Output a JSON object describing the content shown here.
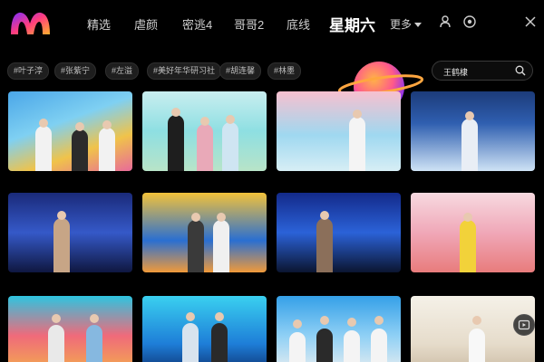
{
  "brand": {
    "logo_icon": "m-logo-icon",
    "accent_colors": [
      "#ff3d7f",
      "#ff9a2e",
      "#7b2cff"
    ]
  },
  "nav": {
    "items": [
      {
        "label": "精选"
      },
      {
        "label": "虐颜"
      },
      {
        "label": "密逃4"
      },
      {
        "label": "哥哥2"
      },
      {
        "label": "底线"
      },
      {
        "label": "星期六",
        "active": true
      }
    ],
    "more_label": "更多",
    "icons": [
      "user-icon",
      "target-icon",
      "close-icon"
    ]
  },
  "tags": [
    "#叶子淳",
    "#张紫宁",
    "#左溢",
    "#美好年华研习社",
    "#胡连馨",
    "#林墨"
  ],
  "search": {
    "value": "王鹤棣",
    "icon": "search-icon"
  },
  "thumbnails": [
    {
      "alt": "thumbnail-1"
    },
    {
      "alt": "thumbnail-2"
    },
    {
      "alt": "thumbnail-3"
    },
    {
      "alt": "thumbnail-4"
    },
    {
      "alt": "thumbnail-5"
    },
    {
      "alt": "thumbnail-6"
    },
    {
      "alt": "thumbnail-7"
    },
    {
      "alt": "thumbnail-8"
    },
    {
      "alt": "thumbnail-9"
    },
    {
      "alt": "thumbnail-10"
    },
    {
      "alt": "thumbnail-11"
    },
    {
      "alt": "thumbnail-12"
    }
  ],
  "floating_button": {
    "icon": "video-icon"
  }
}
